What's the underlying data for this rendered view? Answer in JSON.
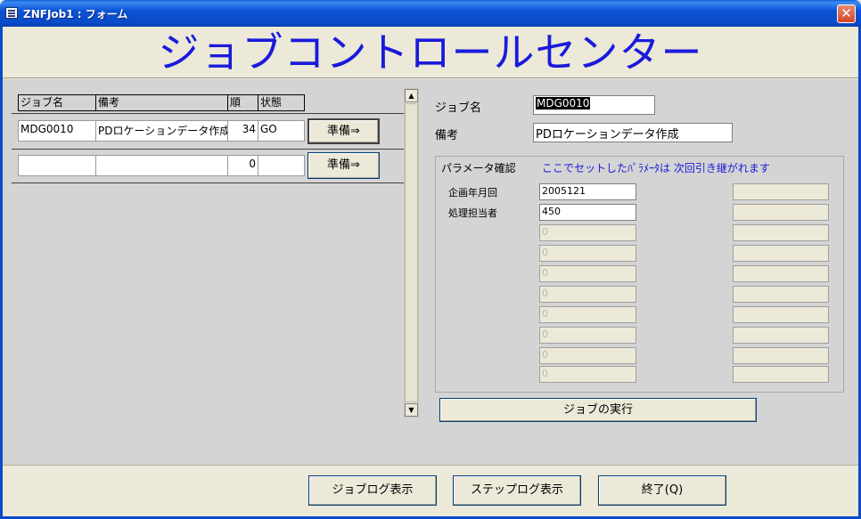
{
  "window": {
    "title": "ZNFJob1 : フォーム",
    "close_glyph": "✕"
  },
  "header": {
    "title": "ジョブコントロールセンター"
  },
  "list": {
    "columns": [
      "ジョブ名",
      "備考",
      "順",
      "状態"
    ],
    "rows": [
      {
        "job": "MDG0010",
        "note": "PDロケーションデータ作成",
        "order": "34",
        "status": "GO",
        "button": "準備⇒"
      },
      {
        "job": "",
        "note": "",
        "order": "0",
        "status": "",
        "button": "準備⇒"
      }
    ]
  },
  "scrollbar": {
    "up": "▲",
    "down": "▼"
  },
  "detail": {
    "job_label": "ジョブ名",
    "job_value": "MDG0010",
    "note_label": "備考",
    "note_value": "PDロケーションデータ作成",
    "param_title": "パラメータ確認",
    "param_note": "ここでセットしたﾊﾟﾗﾒｰﾀは 次回引き継がれます",
    "params": [
      {
        "label": "企画年月回",
        "value": "2005121",
        "right": ""
      },
      {
        "label": "処理担当者",
        "value": "450",
        "right": ""
      },
      {
        "label": "",
        "value": "0",
        "right": ""
      },
      {
        "label": "",
        "value": "0",
        "right": ""
      },
      {
        "label": "",
        "value": "0",
        "right": ""
      },
      {
        "label": "",
        "value": "0",
        "right": ""
      },
      {
        "label": "",
        "value": "0",
        "right": ""
      },
      {
        "label": "",
        "value": "0",
        "right": ""
      },
      {
        "label": "",
        "value": "0",
        "right": ""
      },
      {
        "label": "",
        "value": "0",
        "right": ""
      }
    ],
    "run_button": "ジョブの実行"
  },
  "footer": {
    "joblog_button": "ジョブログ表示",
    "steplog_button": "ステップログ表示",
    "exit_button": "終了(Q)"
  }
}
